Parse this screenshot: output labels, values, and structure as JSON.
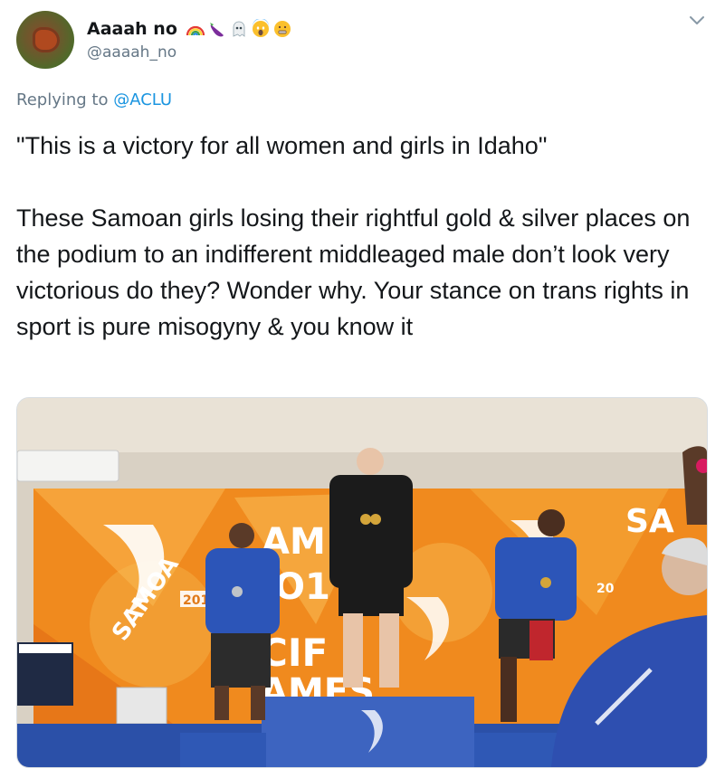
{
  "user": {
    "display_name": "Aaaah no",
    "handle": "@aaaah_no",
    "emojis": [
      "rainbow-emoji",
      "eggplant-emoji",
      "ghost-emoji",
      "scream-emoji",
      "nauseated-emoji"
    ]
  },
  "reply": {
    "prefix": "Replying to",
    "mention": "@ACLU"
  },
  "tweet": {
    "text": "\"This is a victory for all women and girls in Idaho\"\n\nThese Samoan girls losing their rightful gold & silver places on the podium to an indifferent middleaged male don’t look very victorious do they? Wonder why. Your stance on trans rights in sport is pure misogyny & you know it"
  },
  "photo": {
    "banner_texts": [
      "SAMOA",
      "2019",
      "AM",
      "O1",
      "CIF",
      "AMES",
      "SA",
      "20"
    ],
    "medal_colors": {
      "gold": "#d4a53a",
      "silver": "#c0c4c8"
    },
    "brand_colors": {
      "orange": "#f08a1e",
      "blue": "#2b50a8"
    }
  }
}
